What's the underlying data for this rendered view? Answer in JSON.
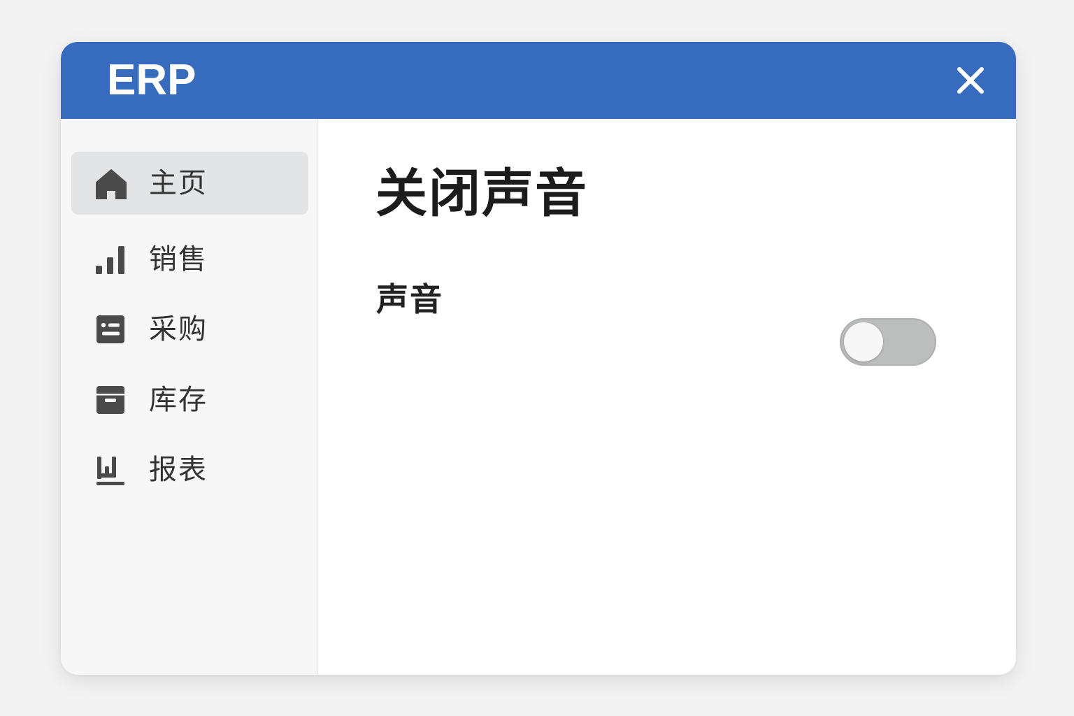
{
  "app": {
    "title": "ERP",
    "header_color": "#366bbd"
  },
  "header": {
    "close_icon": "close-icon"
  },
  "sidebar": {
    "active_index": 0,
    "items": [
      {
        "label": "主页",
        "icon": "home-icon"
      },
      {
        "label": "销售",
        "icon": "bar-chart-icon"
      },
      {
        "label": "采购",
        "icon": "purchase-list-icon"
      },
      {
        "label": "库存",
        "icon": "archive-box-icon"
      },
      {
        "label": "报表",
        "icon": "report-icon"
      }
    ]
  },
  "main": {
    "title": "关闭声音",
    "setting": {
      "label": "声音",
      "toggle_state": "off"
    }
  }
}
